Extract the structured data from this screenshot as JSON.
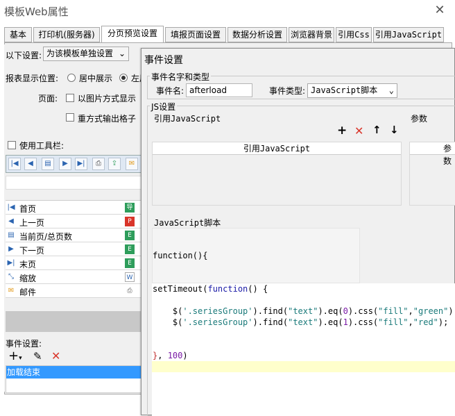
{
  "window": {
    "title": "模板Web属性",
    "close": "✕"
  },
  "tabs": [
    {
      "label": "基本"
    },
    {
      "label": "打印机(服务器)"
    },
    {
      "label": "分页预览设置"
    },
    {
      "label": "填报页面设置"
    },
    {
      "label": "数据分析设置"
    },
    {
      "label": "浏览器背景"
    },
    {
      "label": "引用Css"
    },
    {
      "label": "引用JavaScript"
    }
  ],
  "settings": {
    "scope_label": "以下设置:",
    "scope_value": "为该模板单独设置",
    "position_label": "报表显示位置:",
    "position_center": "居中展示",
    "position_left": "左居",
    "page_label": "页面:",
    "image_option": "以图片方式显示",
    "repeat_option": "重方式输出格子",
    "use_toolbar": "使用工具栏:"
  },
  "toolbar_buttons": [
    {
      "icon": "first-page-icon",
      "glyph": "|◀"
    },
    {
      "icon": "prev-page-icon",
      "glyph": "◀"
    },
    {
      "icon": "page-count-icon",
      "glyph": "▤"
    },
    {
      "icon": "next-page-icon",
      "glyph": "▶"
    },
    {
      "icon": "last-page-icon",
      "glyph": "▶|"
    },
    {
      "icon": "print-icon",
      "glyph": "⎙"
    },
    {
      "icon": "export-icon",
      "glyph": "⇪"
    },
    {
      "icon": "mail-icon",
      "glyph": "✉"
    }
  ],
  "toolbar_items": [
    {
      "label": "首页",
      "icon": "first-page-icon",
      "glyph": "|◀",
      "right": "导",
      "rcolor": "#2e9d5b"
    },
    {
      "label": "上一页",
      "icon": "prev-page-icon",
      "glyph": "◀",
      "right": "P",
      "rcolor": "#d9352a"
    },
    {
      "label": "当前页/总页数",
      "icon": "page-count-icon",
      "glyph": "▤",
      "right": "E",
      "rcolor": "#2e9d5b"
    },
    {
      "label": "下一页",
      "icon": "next-page-icon",
      "glyph": "▶",
      "right": "E",
      "rcolor": "#2e9d5b"
    },
    {
      "label": "末页",
      "icon": "last-page-icon",
      "glyph": "▶|",
      "right": "E",
      "rcolor": "#2e9d5b"
    },
    {
      "label": "缩放",
      "icon": "zoom-icon",
      "glyph": "⤡",
      "right": "W",
      "rcolor": "#2b64b0"
    },
    {
      "label": "邮件",
      "icon": "mail-icon",
      "glyph": "✉",
      "right": "⎙",
      "rcolor": "#666"
    }
  ],
  "events": {
    "label": "事件设置:",
    "add": "+",
    "edit": "✎",
    "delete": "✕",
    "items": [
      "加载结束"
    ]
  },
  "dialog": {
    "title": "事件设置",
    "name_type_group": "事件名字和类型",
    "event_name_label": "事件名:",
    "event_name_value": "afterload",
    "event_type_label": "事件类型:",
    "event_type_value": "JavaScript脚本",
    "js_group": "JS设置",
    "ref_js_label": "引用JavaScript",
    "params_label": "参数",
    "ref_js_header": "引用JavaScript",
    "params_header": "参数",
    "script_label": "JavaScript脚本",
    "function_line": "function(){",
    "code_lines": [
      "setTimeout(function() {",
      "",
      "    $('.seriesGroup').find(\"text\").eq(0).css(\"fill\",\"green\");",
      "    $('.seriesGroup').find(\"text\").eq(1).css(\"fill\",\"red\");",
      "",
      "",
      "}, 100)"
    ],
    "add_btn": "+",
    "del_btn": "✕",
    "up_btn": "↑",
    "down_btn": "↓"
  },
  "colors": {
    "accent": "#3399ff",
    "highlight_line": "#ffffcc",
    "event_selected": "#3399ff"
  }
}
